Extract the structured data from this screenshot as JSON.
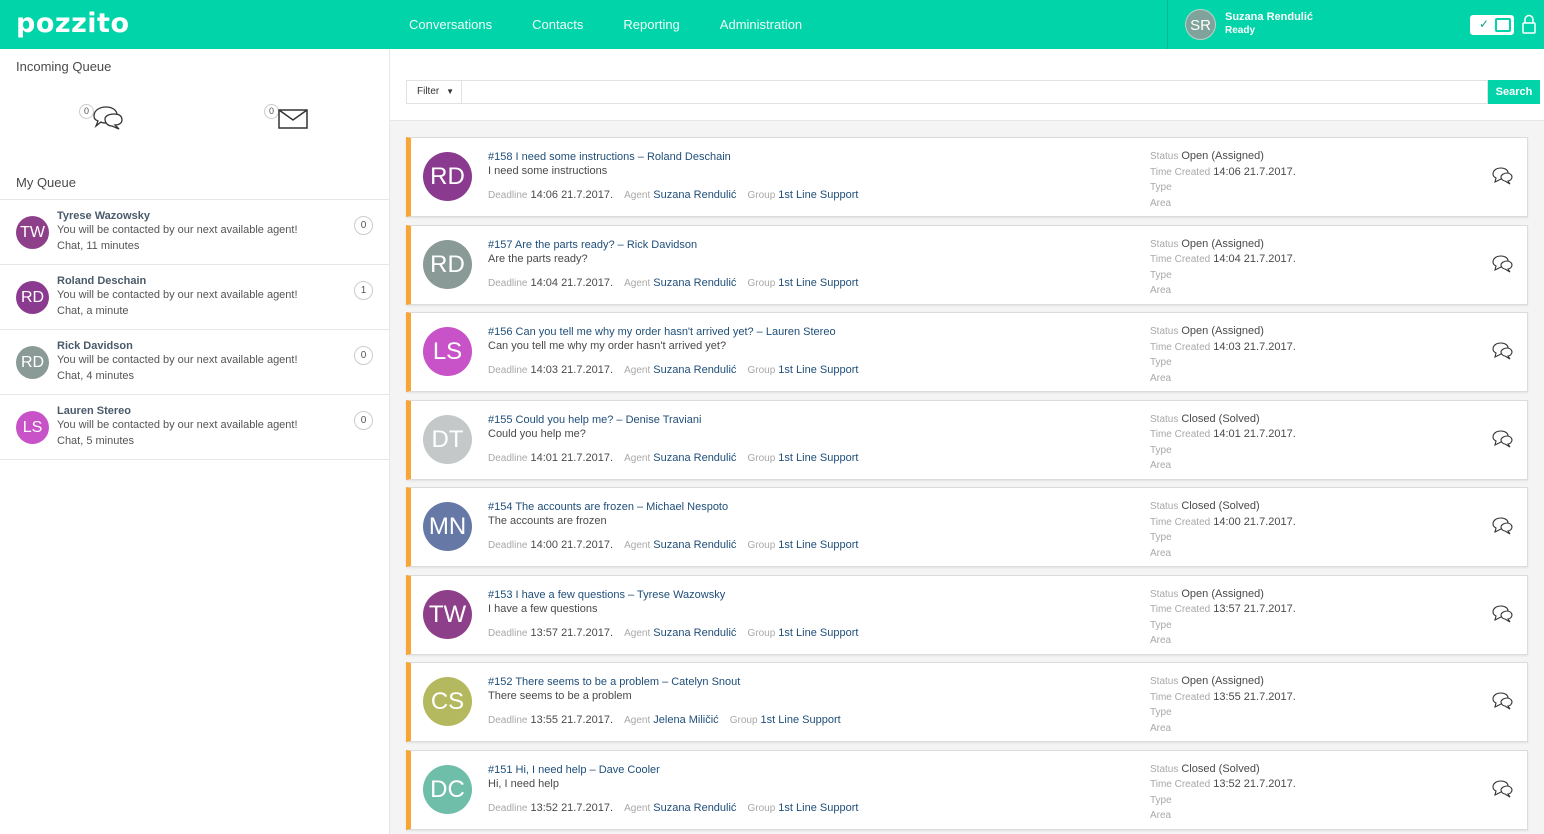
{
  "header": {
    "logo": "pozzito",
    "nav": [
      "Conversations",
      "Contacts",
      "Reporting",
      "Administration"
    ],
    "user": {
      "initials": "SR",
      "name": "Suzana Rendulić",
      "status": "Ready"
    },
    "toggle_check": "✓",
    "colors": {
      "brand": "#00d4a8",
      "accent": "#f7a534",
      "link": "#1f4e79"
    }
  },
  "left": {
    "incoming_title": "Incoming Queue",
    "incoming": [
      {
        "icon": "chat-icon",
        "count": "0"
      },
      {
        "icon": "envelope-icon",
        "count": "0"
      }
    ],
    "my_queue_title": "My Queue",
    "my_queue": [
      {
        "initials": "TW",
        "color": "#8e3f8a",
        "name": "Tyrese Wazowsky",
        "msg": "You will be contacted by our next available agent!",
        "meta": "Chat, 11 minutes",
        "count": "0"
      },
      {
        "initials": "RD",
        "color": "#8b3b8f",
        "name": "Roland Deschain",
        "msg": "You will be contacted by our next available agent!",
        "meta": "Chat, a minute",
        "count": "1"
      },
      {
        "initials": "RD",
        "color": "#8a9a96",
        "name": "Rick Davidson",
        "msg": "You will be contacted by our next available agent!",
        "meta": "Chat, 4 minutes",
        "count": "0"
      },
      {
        "initials": "LS",
        "color": "#c852c8",
        "name": "Lauren Stereo",
        "msg": "You will be contacted by our next available agent!",
        "meta": "Chat, 5 minutes",
        "count": "0"
      }
    ]
  },
  "search": {
    "filter_label": "Filter",
    "button_label": "Search",
    "placeholder": ""
  },
  "labels": {
    "deadline": "Deadline",
    "agent": "Agent",
    "group": "Group",
    "status": "Status",
    "time_created": "Time Created",
    "type": "Type",
    "area": "Area"
  },
  "tickets": [
    {
      "initials": "RD",
      "color": "#8b3b8f",
      "title": "#158 I need some instructions – Roland Deschain",
      "sub": "I need some instructions",
      "deadline": "14:06 21.7.2017.",
      "agent": "Suzana Rendulić",
      "group": "1st Line Support",
      "status": "Open (Assigned)",
      "created": "14:06 21.7.2017."
    },
    {
      "initials": "RD",
      "color": "#8a9a96",
      "title": "#157 Are the parts ready? – Rick Davidson",
      "sub": "Are the parts ready?",
      "deadline": "14:04 21.7.2017.",
      "agent": "Suzana Rendulić",
      "group": "1st Line Support",
      "status": "Open (Assigned)",
      "created": "14:04 21.7.2017."
    },
    {
      "initials": "LS",
      "color": "#c852c8",
      "title": "#156 Can you tell me why my order hasn't arrived yet? – Lauren Stereo",
      "sub": "Can you tell me why my order hasn't arrived yet?",
      "deadline": "14:03 21.7.2017.",
      "agent": "Suzana Rendulić",
      "group": "1st Line Support",
      "status": "Open (Assigned)",
      "created": "14:03 21.7.2017."
    },
    {
      "initials": "DT",
      "color": "#c4c8c9",
      "title": "#155 Could you help me? – Denise Traviani",
      "sub": "Could you help me?",
      "deadline": "14:01 21.7.2017.",
      "agent": "Suzana Rendulić",
      "group": "1st Line Support",
      "status": "Closed (Solved)",
      "created": "14:01 21.7.2017."
    },
    {
      "initials": "MN",
      "color": "#6578a6",
      "title": "#154 The accounts are frozen – Michael Nespoto",
      "sub": "The accounts are frozen",
      "deadline": "14:00 21.7.2017.",
      "agent": "Suzana Rendulić",
      "group": "1st Line Support",
      "status": "Closed (Solved)",
      "created": "14:00 21.7.2017."
    },
    {
      "initials": "TW",
      "color": "#8e3f8a",
      "title": "#153 I have a few questions – Tyrese Wazowsky",
      "sub": "I have a few questions",
      "deadline": "13:57 21.7.2017.",
      "agent": "Suzana Rendulić",
      "group": "1st Line Support",
      "status": "Open (Assigned)",
      "created": "13:57 21.7.2017."
    },
    {
      "initials": "CS",
      "color": "#b4b85e",
      "title": "#152 There seems to be a problem – Catelyn Snout",
      "sub": "There seems to be a problem",
      "deadline": "13:55 21.7.2017.",
      "agent": "Jelena Miličić",
      "group": "1st Line Support",
      "status": "Open (Assigned)",
      "created": "13:55 21.7.2017."
    },
    {
      "initials": "DC",
      "color": "#6fbeaa",
      "title": "#151 Hi, I need help – Dave Cooler",
      "sub": "Hi, I need help",
      "deadline": "13:52 21.7.2017.",
      "agent": "Suzana Rendulić",
      "group": "1st Line Support",
      "status": "Closed (Solved)",
      "created": "13:52 21.7.2017."
    }
  ]
}
